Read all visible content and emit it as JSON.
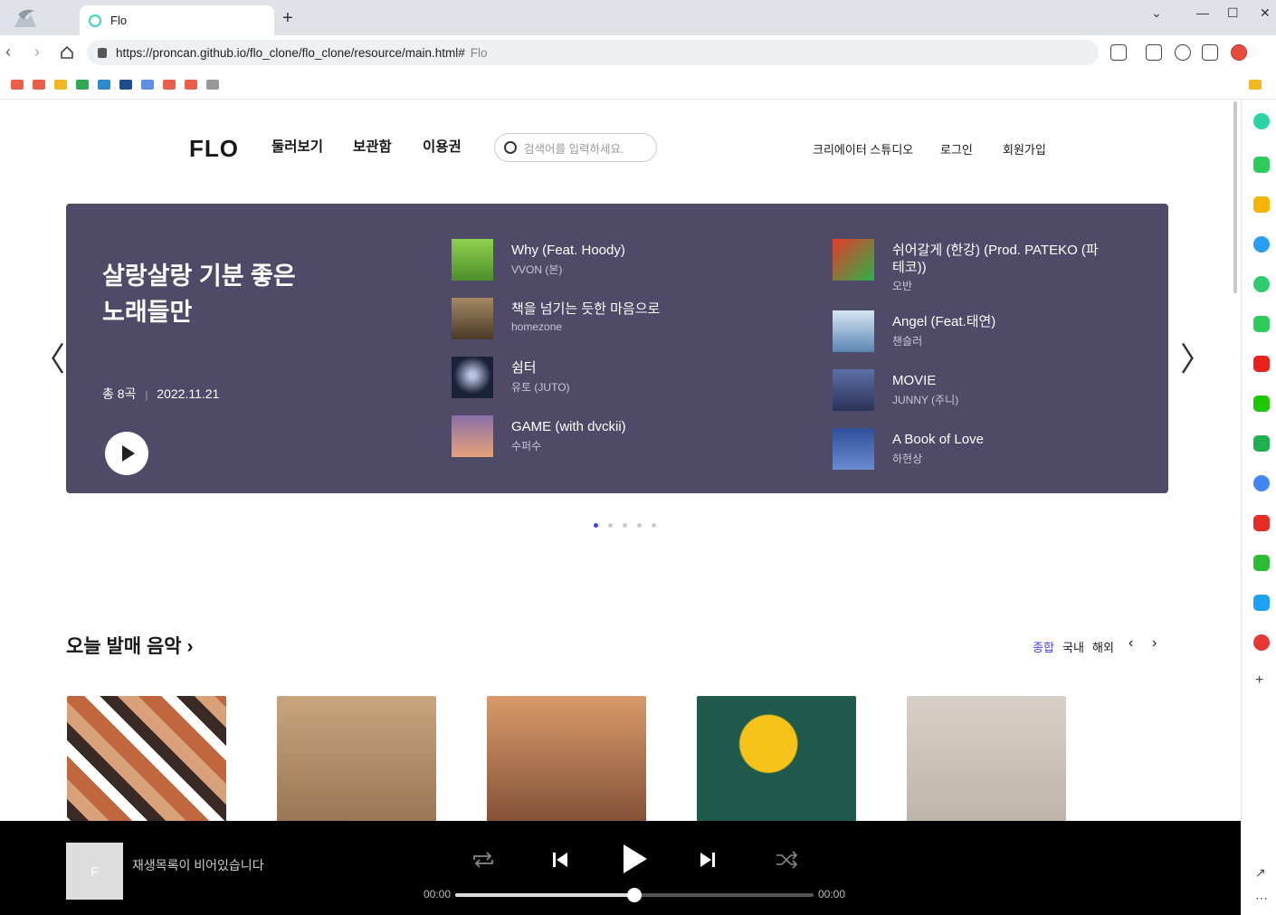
{
  "browser": {
    "tab_title": "Flo",
    "url": "https://proncan.github.io/flo_clone/flo_clone/resource/main.html#",
    "url_suffix": "Flo"
  },
  "header": {
    "logo": "FLO",
    "nav": [
      "둘러보기",
      "보관함",
      "이용권"
    ],
    "search_placeholder": "검색어를 입력하세요.",
    "right": [
      "크리에이터 스튜디오",
      "로그인",
      "회원가입"
    ]
  },
  "banner": {
    "title": "살랑살랑 기분 좋은 노래들만",
    "count": "총 8곡",
    "date": "2022.11.21",
    "tracks": [
      {
        "title": "Why (Feat. Hoody)",
        "artist": "VVON (본)",
        "color": "#5fa33a"
      },
      {
        "title": "책을 넘기는 듯한 마음으로",
        "artist": "homezone",
        "color": "#6b5a44"
      },
      {
        "title": "쉼터",
        "artist": "유토 (JUTO)",
        "color": "#1e2540"
      },
      {
        "title": "GAME (with dvckii)",
        "artist": "수퍼수",
        "color": "#d9876a"
      },
      {
        "title": "쉬어갈게 (한강) (Prod. PATEKO (파테코))",
        "artist": "오반",
        "color": "#e23b2c"
      },
      {
        "title": "Angel (Feat.태연)",
        "artist": "챈슬러",
        "color": "#7aa3c8"
      },
      {
        "title": "MOVIE",
        "artist": "JUNNY (주니)",
        "color": "#3b4a78"
      },
      {
        "title": "A Book of Love",
        "artist": "하현상",
        "color": "#3f5c9c"
      }
    ],
    "page_dots": 5,
    "active_dot": 1
  },
  "section": {
    "title": "오늘 발매 음악",
    "filters": [
      "종합",
      "국내",
      "해외"
    ],
    "active_filter": "종합",
    "album_colors": [
      "#9b5a3a",
      "#c9a57d",
      "#b07a52",
      "#3a6b5c",
      "#cfc7bc"
    ]
  },
  "player": {
    "empty_message": "재생목록이 비어있습니다",
    "thumb_letter": "F",
    "time_current": "00:00",
    "time_total": "00:00",
    "progress": 0.5
  },
  "colors": {
    "accent": "#3f3fff",
    "banner_bg": "#4e4a68"
  }
}
